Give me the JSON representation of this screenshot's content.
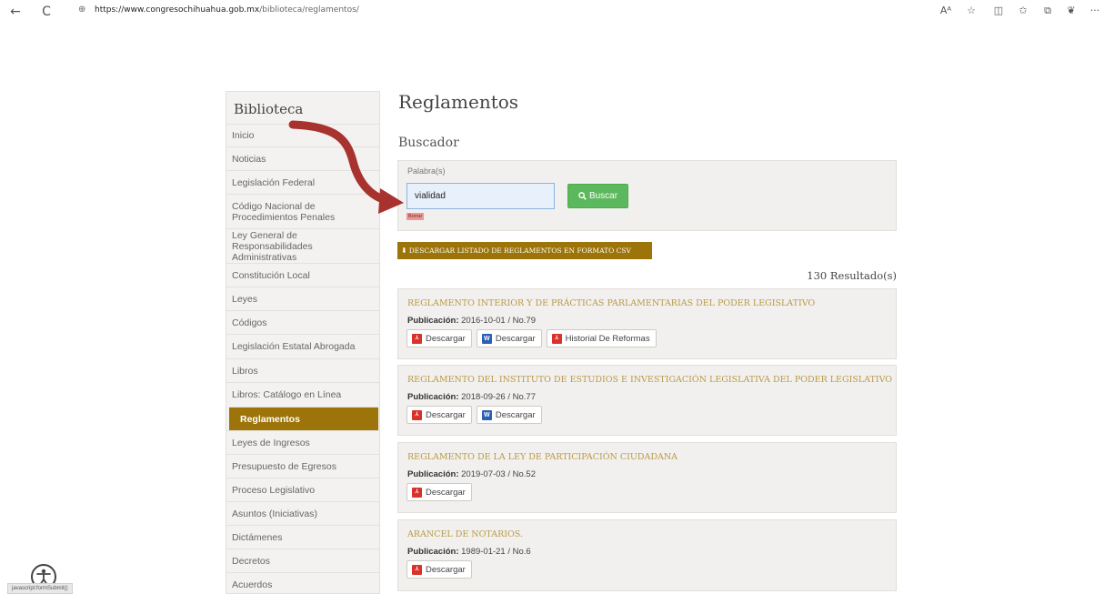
{
  "browser": {
    "url_host": "https://www.congresochihuahua.gob.mx",
    "url_path": "/biblioteca/reglamentos/",
    "back": "←",
    "refresh": "C",
    "lock": "⊕",
    "icons": [
      "Aᴬ",
      "☆",
      "◫",
      "✩",
      "⧉",
      "❦",
      "···"
    ]
  },
  "sidebar": {
    "title": "Biblioteca",
    "items": [
      {
        "label": "Inicio"
      },
      {
        "label": "Noticias"
      },
      {
        "label": "Legislación Federal"
      },
      {
        "label": "Código Nacional de Procedimientos Penales"
      },
      {
        "label": "Ley General de Responsabilidades Administrativas"
      },
      {
        "label": "Constitución Local"
      },
      {
        "label": "Leyes"
      },
      {
        "label": "Códigos"
      },
      {
        "label": "Legislación Estatal Abrogada"
      },
      {
        "label": "Libros"
      },
      {
        "label": "Libros: Catálogo en Línea"
      },
      {
        "label": "Reglamentos",
        "active": true
      },
      {
        "label": "Leyes de Ingresos"
      },
      {
        "label": "Presupuesto de Egresos"
      },
      {
        "label": "Proceso Legislativo"
      },
      {
        "label": "Asuntos (Iniciativas)"
      },
      {
        "label": "Dictámenes"
      },
      {
        "label": "Decretos"
      },
      {
        "label": "Acuerdos"
      }
    ]
  },
  "main": {
    "title": "Reglamentos",
    "search_heading": "Buscador",
    "search_label": "Palabra(s)",
    "search_value": "vialidad",
    "search_button": "Buscar",
    "clear_label": "Borrar",
    "csv_button": "DESCARGAR LISTADO DE REGLAMENTOS EN FORMATO CSV",
    "results_count": "130 Resultado(s)",
    "pub_label": "Publicación:",
    "results": [
      {
        "title": "REGLAMENTO INTERIOR Y DE PRÁCTICAS PARLAMENTARIAS DEL PODER LEGISLATIVO",
        "publication": "2016-10-01 / No.79",
        "actions": [
          {
            "type": "pdf",
            "label": "Descargar"
          },
          {
            "type": "word",
            "label": "Descargar"
          },
          {
            "type": "pdf",
            "label": "Historial De Reformas"
          }
        ]
      },
      {
        "title": "REGLAMENTO DEL INSTITUTO DE ESTUDIOS E INVESTIGACIÓN LEGISLATIVA DEL PODER LEGISLATIVO",
        "publication": "2018-09-26 / No.77",
        "actions": [
          {
            "type": "pdf",
            "label": "Descargar"
          },
          {
            "type": "word",
            "label": "Descargar"
          }
        ]
      },
      {
        "title": "REGLAMENTO DE LA LEY DE PARTICIPACIÓN CIUDADANA",
        "publication": "2019-07-03 / No.52",
        "actions": [
          {
            "type": "pdf",
            "label": "Descargar"
          }
        ]
      },
      {
        "title": "ARANCEL DE NOTARIOS.",
        "publication": "1989-01-21 / No.6",
        "actions": [
          {
            "type": "pdf",
            "label": "Descargar"
          }
        ]
      }
    ]
  },
  "status_tip": "javascript:formSubmit()",
  "colors": {
    "accent": "#9c7409",
    "title_gold": "#b89a45",
    "search_green": "#5cb85c",
    "annotation_arrow": "#a8322d"
  }
}
